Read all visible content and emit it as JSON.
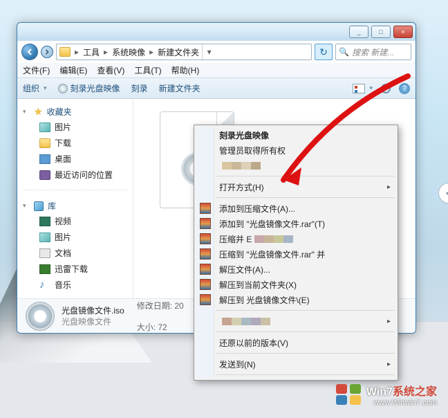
{
  "titlebar": {
    "min": "_",
    "max": "□",
    "close": "×"
  },
  "breadcrumbs": {
    "items": [
      "工具",
      "系统映像",
      "新建文件夹"
    ],
    "sep": "▸"
  },
  "search": {
    "placeholder": "搜索 新建..."
  },
  "menubar": {
    "items": [
      "文件(F)",
      "编辑(E)",
      "查看(V)",
      "工具(T)",
      "帮助(H)"
    ]
  },
  "toolbar": {
    "organize": "组织",
    "burn_image": "刻录光盘映像",
    "burn": "刻录",
    "new_folder": "新建文件夹",
    "chev": "▾",
    "help": "?"
  },
  "sidebar": {
    "favorites": {
      "tri": "▾",
      "label": "收藏夹",
      "items": [
        {
          "label": "图片"
        },
        {
          "label": "下载"
        },
        {
          "label": "桌面"
        },
        {
          "label": "最近访问的位置"
        }
      ]
    },
    "libraries": {
      "tri": "▾",
      "label": "库",
      "items": [
        {
          "label": "视频"
        },
        {
          "label": "图片"
        },
        {
          "label": "文档"
        },
        {
          "label": "迅雷下载"
        },
        {
          "label": "音乐"
        }
      ]
    }
  },
  "status": {
    "filename": "光盘镜像文件.iso",
    "filetype": "光盘映像文件",
    "date_label": "修改日期:",
    "date_value": "20",
    "size_label": "大小:",
    "size_value": "72"
  },
  "context_menu": {
    "burn_image": "刻录光盘映像",
    "admin_own": "管理员取得所有权",
    "censored1": "",
    "open_with": "打开方式(H)",
    "rar_add": "添加到压缩文件(A)...",
    "rar_add_name": "添加到 \"光盘镜像文件.rar\"(T)",
    "rar_compress_e": "压缩并 E",
    "rar_compress_name": "压缩到 \"光盘镜像文件.rar\" 并",
    "rar_extract": "解压文件(A)...",
    "rar_extract_here": "解压到当前文件夹(X)",
    "rar_extract_to": "解压到 光盘镜像文件\\(E)",
    "restore": "还原以前的版本(V)",
    "send_to": "发送到(N)",
    "arrow": "▸"
  },
  "side_chevron": "<",
  "watermark": {
    "line1_a": "Win7",
    "line1_b": "系统之家",
    "line2": "www.Winwin7.com"
  },
  "censor_colors": {
    "a": [
      "#d9c7a2",
      "#cbb89a",
      "#dcd1b8",
      "#bca98a"
    ],
    "b": [
      "#c7a7a7",
      "#c7b59a",
      "#c7c79a",
      "#a7b6c7"
    ],
    "c": [
      "#c7a391",
      "#d4ceb1",
      "#a9bac1",
      "#b0a9bb",
      "#cac0a6"
    ]
  }
}
